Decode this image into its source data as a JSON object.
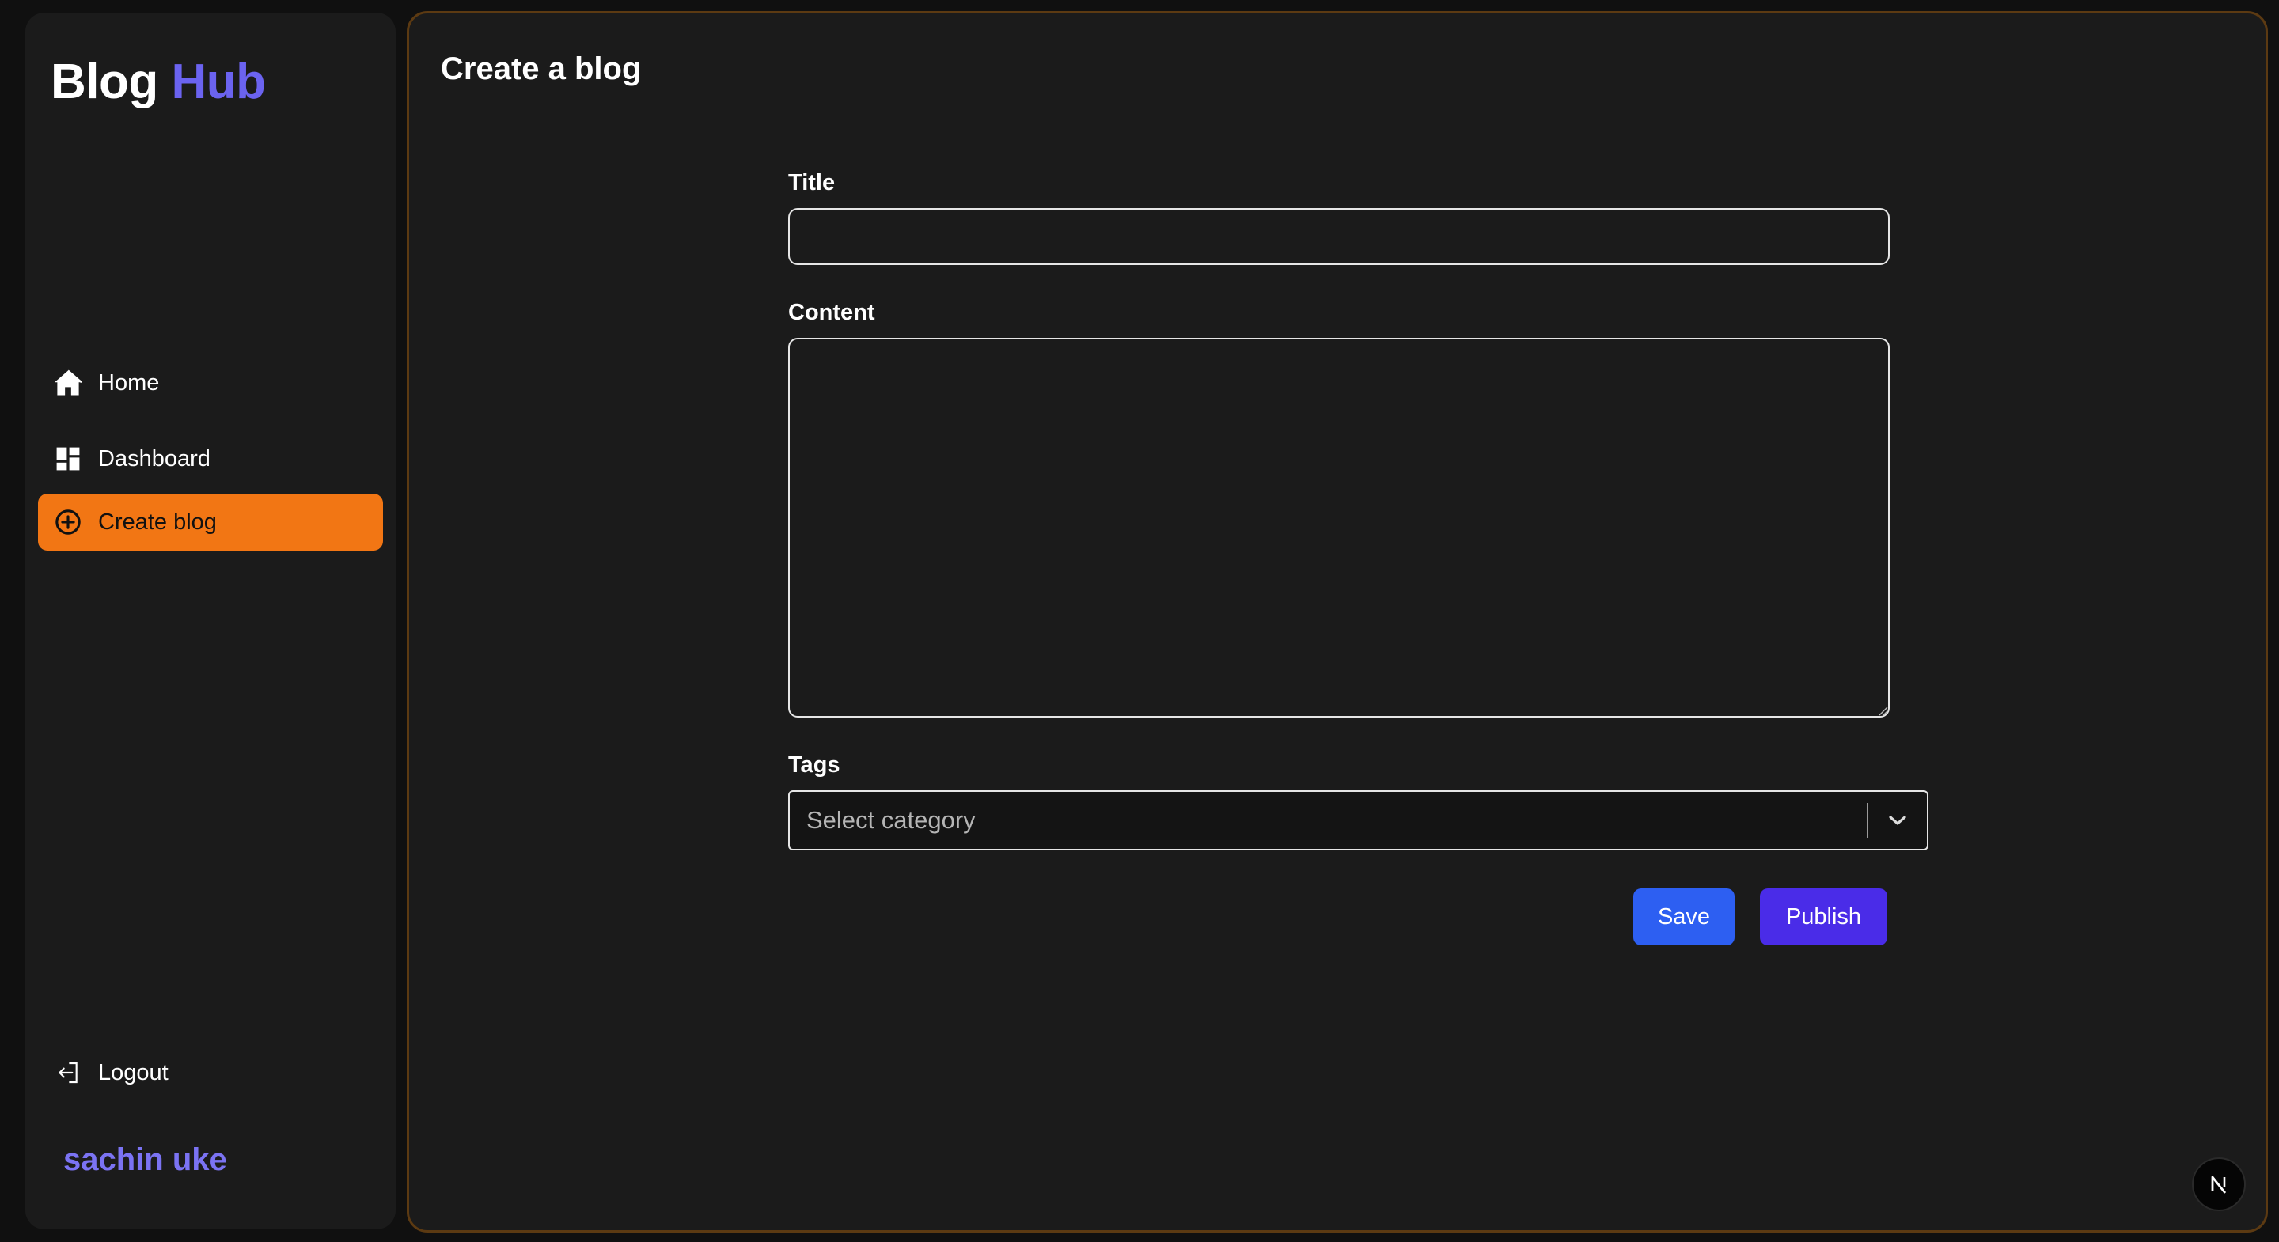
{
  "app": {
    "logo_part1": "Blog",
    "logo_part2": "Hub"
  },
  "sidebar": {
    "items": [
      {
        "label": "Home",
        "icon": "home-icon"
      },
      {
        "label": "Dashboard",
        "icon": "dashboard-icon"
      },
      {
        "label": "Create blog",
        "icon": "plus-circle-icon",
        "active": true
      }
    ],
    "logout_label": "Logout",
    "user_name": "sachin uke"
  },
  "main": {
    "page_title": "Create a blog",
    "form": {
      "title_label": "Title",
      "title_value": "",
      "content_label": "Content",
      "content_value": "",
      "tags_label": "Tags",
      "tags_placeholder": "Select category",
      "save_label": "Save",
      "publish_label": "Publish"
    }
  },
  "colors": {
    "accent_orange": "#f27614",
    "brand_purple": "#6b63f0",
    "save_blue": "#2d5ff2",
    "publish_indigo": "#4a2ce8",
    "panel_bg": "#1b1b1b"
  },
  "badge": {
    "label": "N",
    "icon": "nextjs-icon"
  }
}
